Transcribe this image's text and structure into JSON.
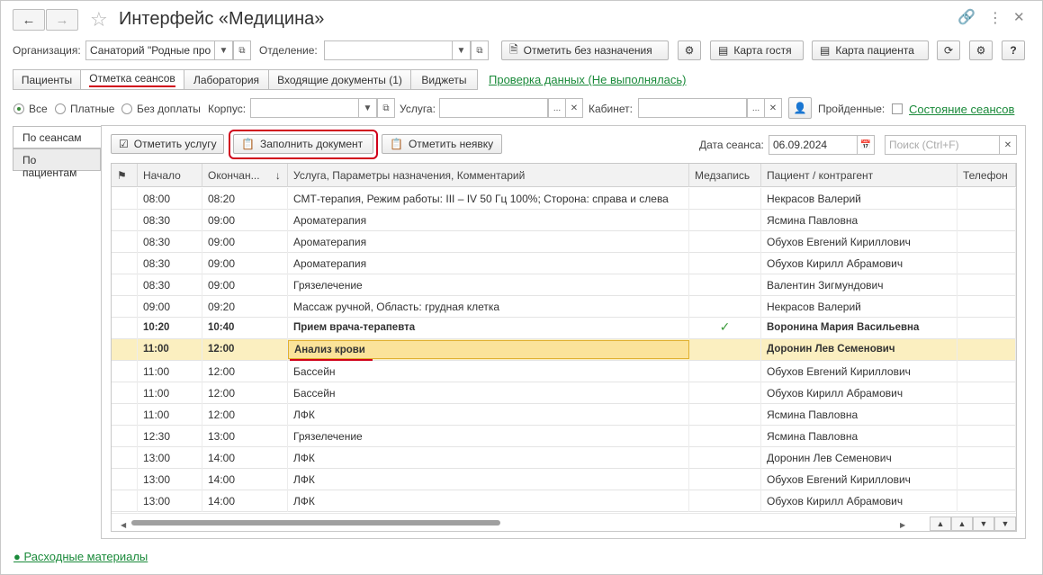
{
  "window": {
    "title": "Интерфейс «Медицина»"
  },
  "filters": {
    "org_label": "Организация:",
    "org_value": "Санаторий \"Родные про",
    "dept_label": "Отделение:",
    "dept_value": "",
    "corpus_label": "Корпус:",
    "service_label": "Услуга:",
    "cabinet_label": "Кабинет:",
    "passed_label": "Пройденные:",
    "radio_all": "Все",
    "radio_paid": "Платные",
    "radio_free": "Без доплаты"
  },
  "toolbar": {
    "mark_without_label": "Отметить без назначения",
    "guest_card_label": "Карта гостя",
    "patient_card_label": "Карта пациента"
  },
  "tabs": [
    {
      "label": "Пациенты"
    },
    {
      "label": "Отметка сеансов"
    },
    {
      "label": "Лаборатория"
    },
    {
      "label": "Входящие документы (1)"
    },
    {
      "label": "Виджеты"
    }
  ],
  "links": {
    "check_data": "Проверка данных (Не выполнялась)",
    "session_state": "Состояние сеансов",
    "consumables": "● Расходные материалы"
  },
  "side_tabs": [
    {
      "label": "По сеансам"
    },
    {
      "label": "По пациентам"
    }
  ],
  "actions": {
    "mark_service": "Отметить услугу",
    "fill_document": "Заполнить документ",
    "mark_noshow": "Отметить неявку",
    "date_label": "Дата сеанса:",
    "date_value": "06.09.2024",
    "search_placeholder": "Поиск (Ctrl+F)"
  },
  "table": {
    "columns": {
      "start": "Начало",
      "end": "Окончан...",
      "service": "Услуга, Параметры назначения, Комментарий",
      "record": "Медзапись",
      "patient": "Пациент / контрагент",
      "phone": "Телефон"
    },
    "rows": [
      {
        "start": "08:00",
        "end": "08:20",
        "service": "СМТ-терапия, Режим работы: III – IV 50 Гц 100%; Сторона: справа и слева",
        "record": "",
        "patient": "Некрасов Валерий"
      },
      {
        "start": "08:30",
        "end": "09:00",
        "service": "Ароматерапия",
        "record": "",
        "patient": "Ясмина Павловна"
      },
      {
        "start": "08:30",
        "end": "09:00",
        "service": "Ароматерапия",
        "record": "",
        "patient": "Обухов Евгений Кириллович"
      },
      {
        "start": "08:30",
        "end": "09:00",
        "service": "Ароматерапия",
        "record": "",
        "patient": "Обухов Кирилл Абрамович"
      },
      {
        "start": "08:30",
        "end": "09:00",
        "service": "Грязелечение",
        "record": "",
        "patient": "Валентин Зигмундович"
      },
      {
        "start": "09:00",
        "end": "09:20",
        "service": "Массаж ручной, Область: грудная клетка",
        "record": "",
        "patient": "Некрасов Валерий"
      },
      {
        "start": "10:20",
        "end": "10:40",
        "service": "Прием врача-терапевта",
        "record": "✓",
        "patient": "Воронина Мария Васильевна"
      },
      {
        "start": "11:00",
        "end": "12:00",
        "service": "Анализ крови",
        "record": "",
        "patient": "Доронин Лев Семенович"
      },
      {
        "start": "11:00",
        "end": "12:00",
        "service": "Бассейн",
        "record": "",
        "patient": "Обухов Евгений Кириллович"
      },
      {
        "start": "11:00",
        "end": "12:00",
        "service": "Бассейн",
        "record": "",
        "patient": "Обухов Кирилл Абрамович"
      },
      {
        "start": "11:00",
        "end": "12:00",
        "service": "ЛФК",
        "record": "",
        "patient": "Ясмина Павловна"
      },
      {
        "start": "12:30",
        "end": "13:00",
        "service": "Грязелечение",
        "record": "",
        "patient": "Ясмина Павловна"
      },
      {
        "start": "13:00",
        "end": "14:00",
        "service": "ЛФК",
        "record": "",
        "patient": "Доронин Лев Семенович"
      },
      {
        "start": "13:00",
        "end": "14:00",
        "service": "ЛФК",
        "record": "",
        "patient": "Обухов Евгений Кириллович"
      },
      {
        "start": "13:00",
        "end": "14:00",
        "service": "ЛФК",
        "record": "",
        "patient": "Обухов Кирилл Абрамович"
      }
    ]
  },
  "colors": {
    "accent_red": "#d0021b",
    "link_green": "#1a8a3a",
    "selected_row": "#fbefc0",
    "check_green": "#3a9a3a"
  }
}
